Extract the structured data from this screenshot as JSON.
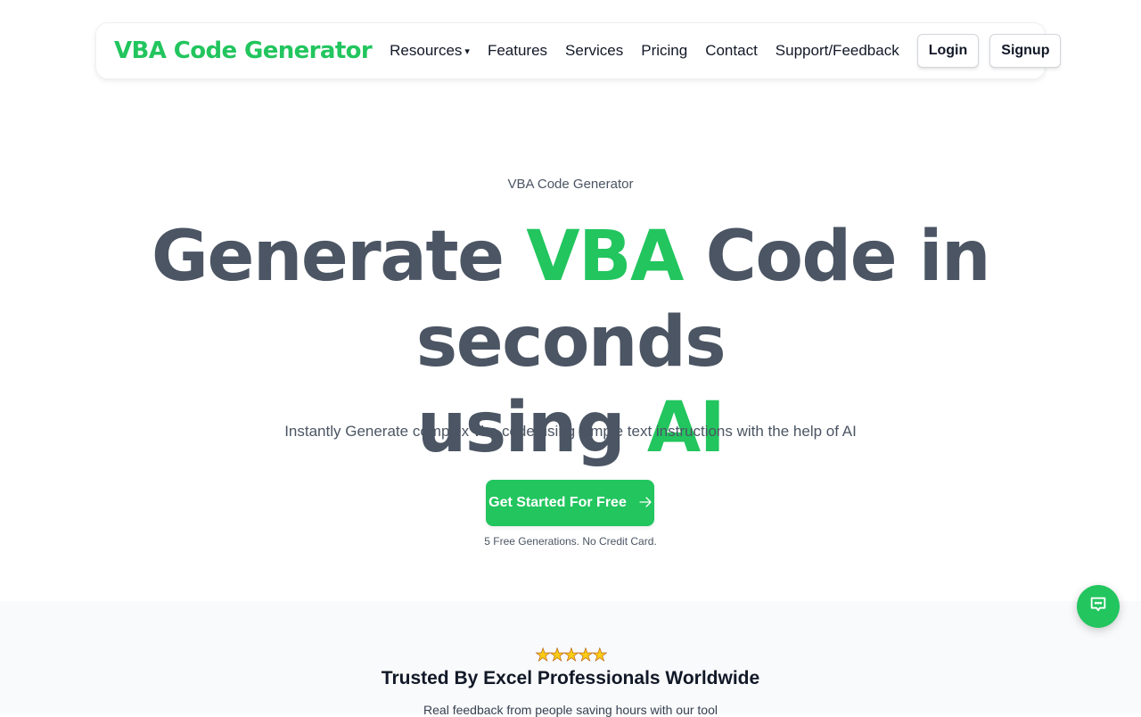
{
  "nav": {
    "brand": "VBA Code Generator",
    "links": [
      {
        "label": "Resources",
        "has_dropdown": true
      },
      {
        "label": "Features"
      },
      {
        "label": "Services"
      },
      {
        "label": "Pricing"
      },
      {
        "label": "Contact"
      },
      {
        "label": "Support/Feedback"
      }
    ],
    "dropdown_icon": "▾",
    "login_label": "Login",
    "signup_label": "Signup"
  },
  "hero": {
    "eyebrow": "VBA Code Generator",
    "headline": {
      "part1": "Generate ",
      "highlight1": "VBA",
      "part2": " Code in seconds",
      "part3": "using ",
      "highlight2": "AI"
    },
    "subhead": "Instantly Generate complex vba code using simple text instructions with the help of AI",
    "cta_label": "Get Started For Free",
    "cta_icon": "arrow-right-icon",
    "cta_note": "5 Free Generations. No Credit Card."
  },
  "trust": {
    "rating_stars": 5,
    "star_glyph": "★★★★★",
    "title": "Trusted By Excel Professionals Worldwide",
    "subtitle": "Real feedback from people saving hours with our tool"
  },
  "chat": {
    "icon": "chat-bubble-icon"
  },
  "colors": {
    "accent": "#22c55e",
    "text": "#4b5563",
    "heading": "#111827",
    "section_bg": "#f9fafb"
  }
}
